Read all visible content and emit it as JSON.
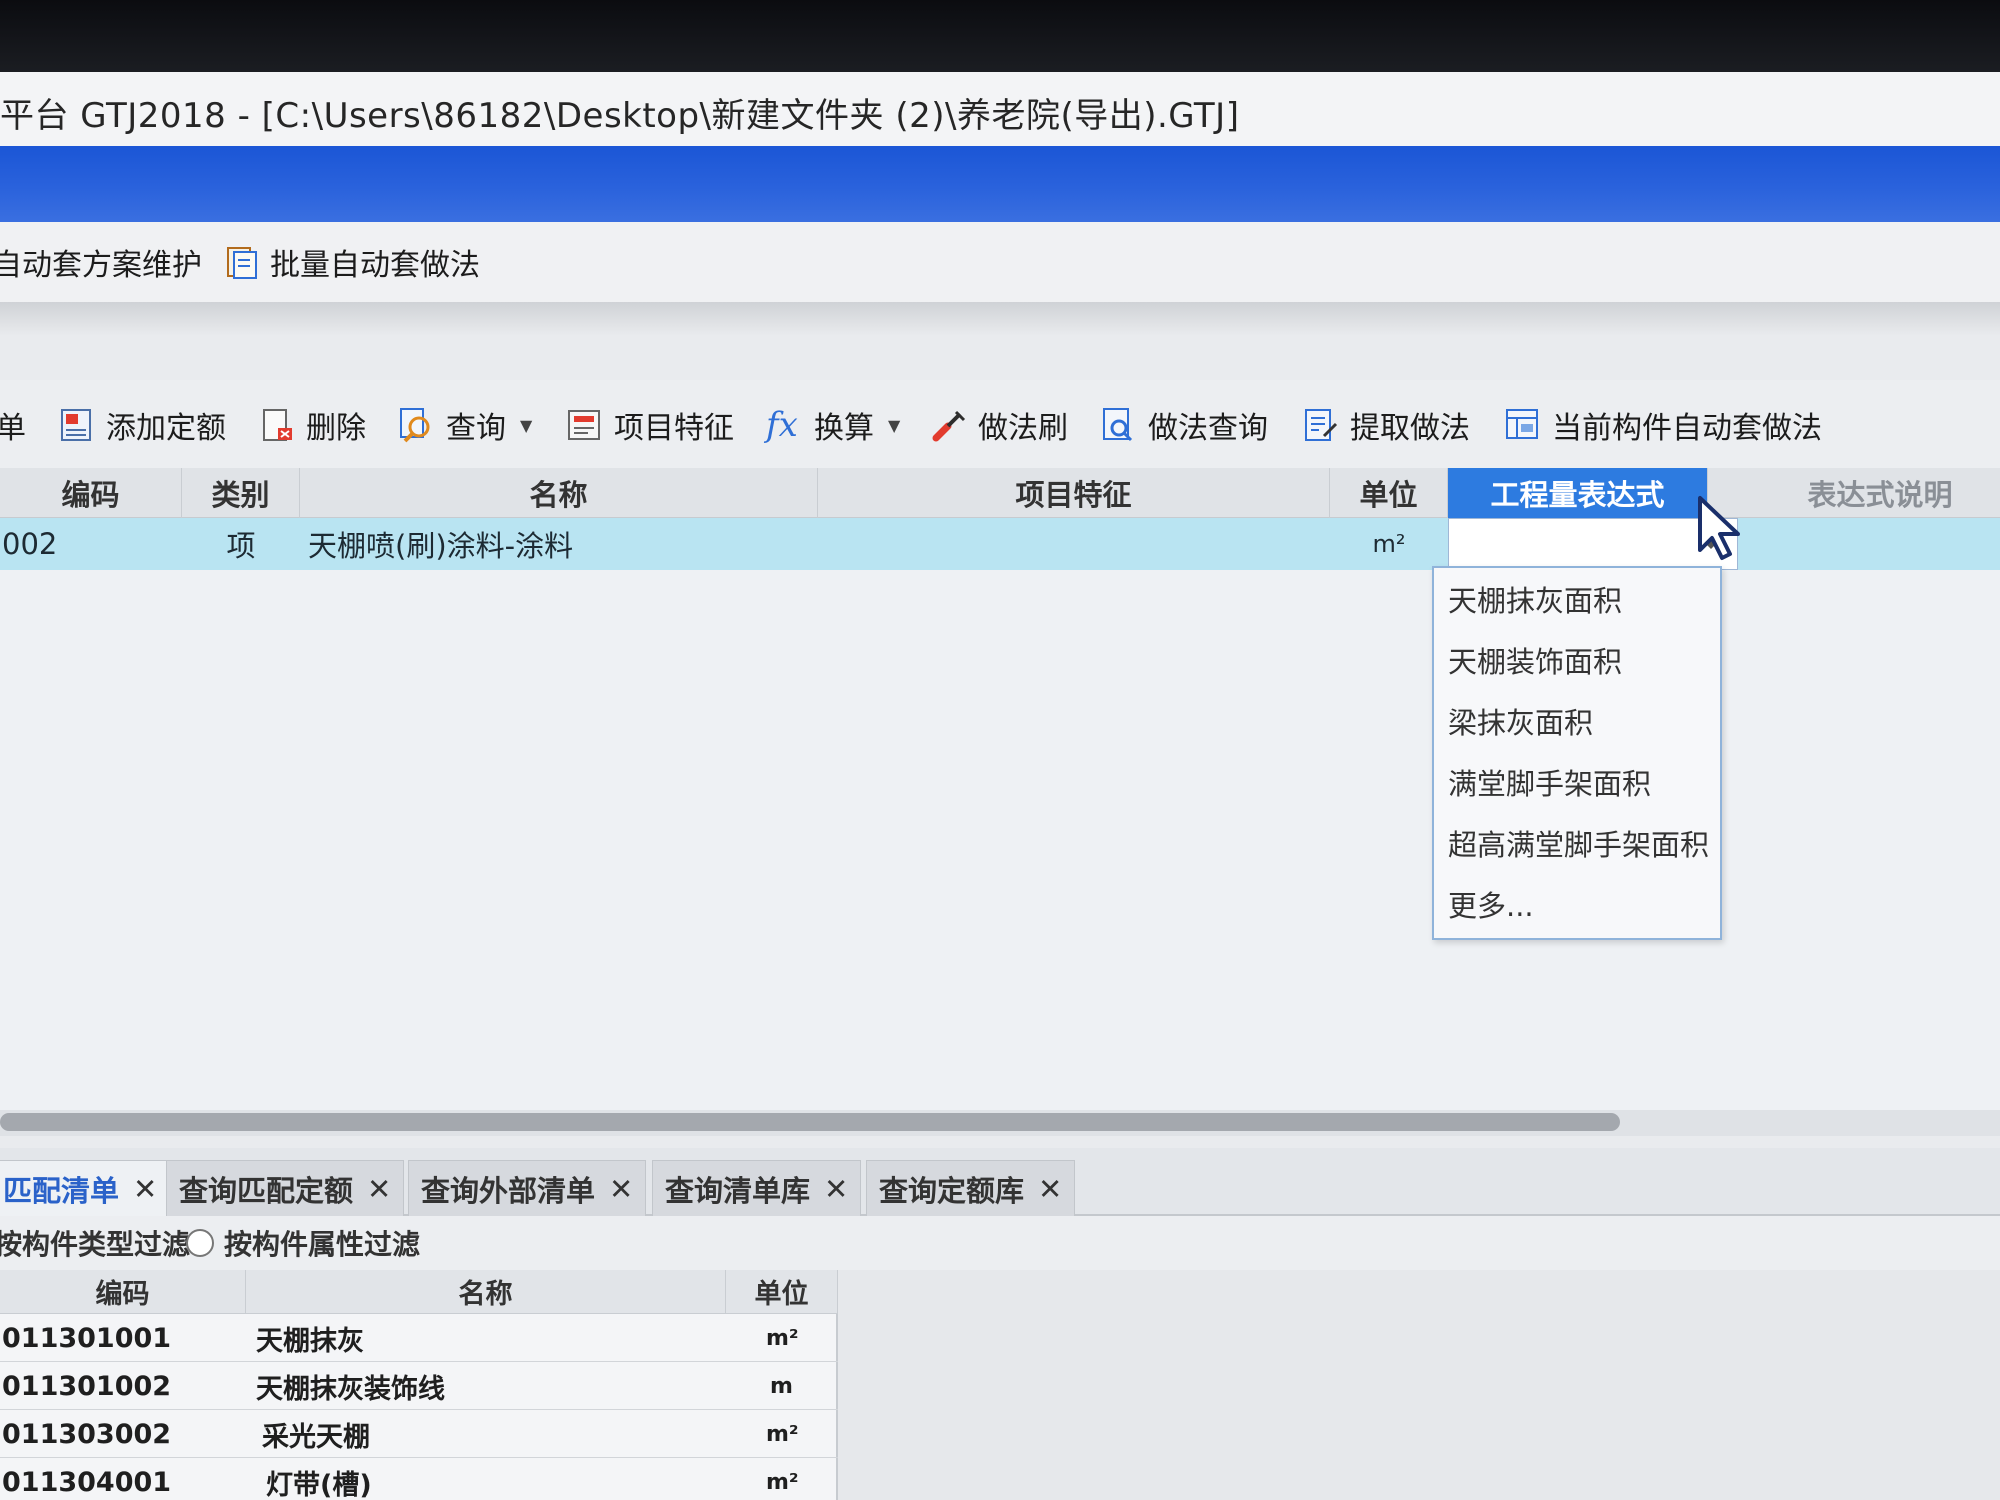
{
  "window": {
    "title": "平台 GTJ2018 - [C:\\Users\\86182\\Desktop\\新建文件夹 (2)\\养老院(导出).GTJ]"
  },
  "toolbar1": {
    "items": [
      {
        "label": "自动套方案维护",
        "icon": "scheme-icon"
      },
      {
        "label": "批量自动套做法",
        "icon": "batch-icon"
      }
    ]
  },
  "toolbar2": {
    "items": [
      {
        "label": "单",
        "icon": ""
      },
      {
        "label": "添加定额",
        "icon": "add-quota-icon"
      },
      {
        "label": "删除",
        "icon": "delete-icon"
      },
      {
        "label": "查询",
        "icon": "search-icon",
        "dropdown": true
      },
      {
        "label": "项目特征",
        "icon": "feature-icon"
      },
      {
        "label": "换算",
        "icon": "fx-icon",
        "dropdown": true
      },
      {
        "label": "做法刷",
        "icon": "brush-icon"
      },
      {
        "label": "做法查询",
        "icon": "method-query-icon"
      },
      {
        "label": "提取做法",
        "icon": "extract-icon"
      },
      {
        "label": "当前构件自动套做法",
        "icon": "auto-apply-icon"
      }
    ]
  },
  "grid": {
    "columns": [
      "编码",
      "类别",
      "名称",
      "项目特征",
      "单位",
      "工程量表达式",
      "表达式说明"
    ],
    "selected_row": {
      "code": "002",
      "type": "项",
      "name": "天棚喷(刷)涂料-涂料",
      "feature": "",
      "unit": "m²",
      "expression": ""
    }
  },
  "dropdown": {
    "options": [
      "天棚抹灰面积",
      "天棚装饰面积",
      "梁抹灰面积",
      "满堂脚手架面积",
      "超高满堂脚手架面积",
      "更多..."
    ]
  },
  "bottom_tabs": [
    {
      "label": "匹配清单",
      "active": true
    },
    {
      "label": "查询匹配定额",
      "active": false
    },
    {
      "label": "查询外部清单",
      "active": false
    },
    {
      "label": "查询清单库",
      "active": false
    },
    {
      "label": "查询定额库",
      "active": false
    }
  ],
  "filters": {
    "by_type": "按构件类型过滤",
    "by_attr": "按构件属性过滤"
  },
  "bottom_table": {
    "columns": [
      "编码",
      "名称",
      "单位"
    ],
    "rows": [
      {
        "code": "011301001",
        "name": "天棚抹灰",
        "unit": "m²"
      },
      {
        "code": "011301002",
        "name": "天棚抹灰装饰线",
        "unit": "m"
      },
      {
        "code": "011303002",
        "name": "采光天棚",
        "unit": "m²"
      },
      {
        "code": "011304001",
        "name": "灯带(槽)",
        "unit": "m²"
      }
    ]
  },
  "colors": {
    "ribbon_blue": "#1b56d6",
    "selected_row": "#b9e4f2",
    "active_header": "#2d7be0"
  }
}
